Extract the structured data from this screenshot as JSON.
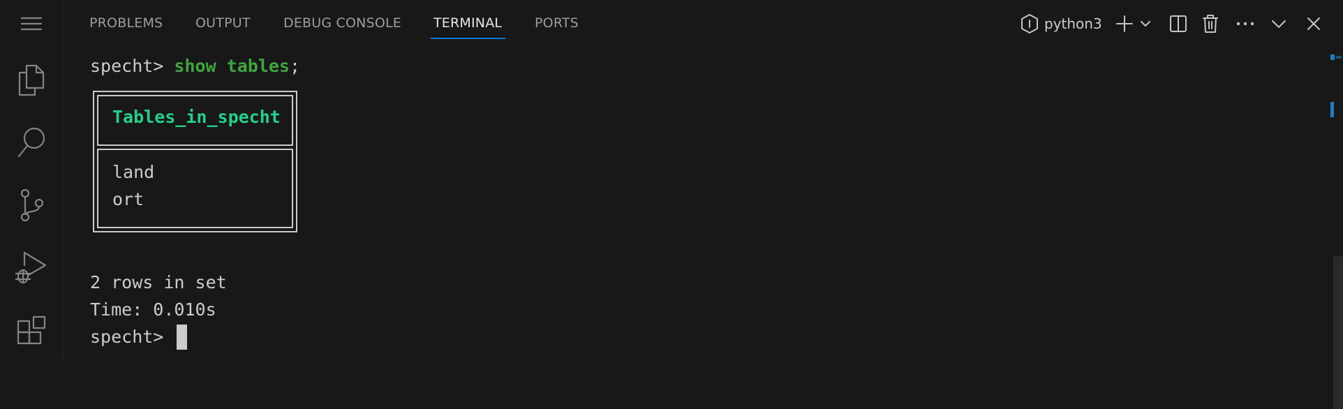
{
  "panel": {
    "tabs": [
      {
        "label": "PROBLEMS"
      },
      {
        "label": "OUTPUT"
      },
      {
        "label": "DEBUG CONSOLE"
      },
      {
        "label": "TERMINAL"
      },
      {
        "label": "PORTS"
      }
    ],
    "active_tab": "TERMINAL",
    "terminal_profile": "python3"
  },
  "activity_bar": {
    "icons": [
      "menu-icon",
      "explorer-icon",
      "search-icon",
      "source-control-icon",
      "run-debug-icon",
      "extensions-icon"
    ]
  },
  "toolbar_icons": [
    "python-profile-icon",
    "new-terminal-icon",
    "chevron-down-icon",
    "split-terminal-icon",
    "trash-icon",
    "more-actions-icon",
    "chevron-down-icon",
    "close-icon"
  ],
  "terminal": {
    "prompt": "specht> ",
    "command": "show tables",
    "command_terminator": ";",
    "table": {
      "header": "Tables_in_specht",
      "rows": [
        "land",
        "ort"
      ]
    },
    "summary": "2 rows in set",
    "time": "Time: 0.010s",
    "final_prompt": "specht> "
  },
  "colors": {
    "background": "#181818",
    "text": "#cccccc",
    "command_green": "#3fa63f",
    "header_green": "#23d18b",
    "accent_blue": "#0078d4"
  }
}
